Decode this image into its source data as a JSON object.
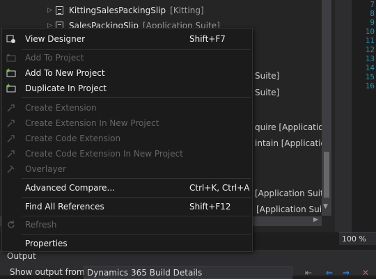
{
  "explorer": {
    "rows": [
      {
        "name": "KittingSalesPackingSlip",
        "tag": "[Kitting]"
      },
      {
        "name": "SalesPackingSlip",
        "tag": "[Application Suite]"
      }
    ],
    "partials": [
      "Suite]",
      "Suite]",
      "quire   [Application",
      "intain   [Applicatio",
      "[Application Suite]",
      "[Application Suite"
    ]
  },
  "editor": {
    "line_numbers": [
      "7",
      "8",
      "9",
      "10",
      "11",
      "12",
      "13",
      "14",
      "15",
      "16"
    ],
    "zoom": "100 %"
  },
  "context_menu": {
    "items": [
      {
        "icon": "view-designer-icon",
        "label": "View Designer",
        "shortcut": "Shift+F7",
        "enabled": true
      },
      {
        "icon": "add-to-project-icon",
        "label": "Add To Project",
        "shortcut": "",
        "enabled": false
      },
      {
        "icon": "add-to-new-project-icon",
        "label": "Add To New Project",
        "shortcut": "",
        "enabled": true
      },
      {
        "icon": "duplicate-in-project-icon",
        "label": "Duplicate In Project",
        "shortcut": "",
        "enabled": true
      },
      {
        "icon": "create-extension-icon",
        "label": "Create Extension",
        "shortcut": "",
        "enabled": false
      },
      {
        "icon": "create-extension-new-project-icon",
        "label": "Create Extension In New Project",
        "shortcut": "",
        "enabled": false
      },
      {
        "icon": "create-code-extension-icon",
        "label": "Create Code Extension",
        "shortcut": "",
        "enabled": false
      },
      {
        "icon": "create-code-extension-new-project-icon",
        "label": "Create Code Extension In New Project",
        "shortcut": "",
        "enabled": false
      },
      {
        "icon": "overlayer-icon",
        "label": "Overlayer",
        "shortcut": "",
        "enabled": false
      },
      {
        "icon": "",
        "label": "Advanced Compare...",
        "shortcut": "Ctrl+K, Ctrl+A",
        "enabled": true
      },
      {
        "icon": "",
        "label": "Find All References",
        "shortcut": "Shift+F12",
        "enabled": true
      },
      {
        "icon": "refresh-icon",
        "label": "Refresh",
        "shortcut": "",
        "enabled": false
      },
      {
        "icon": "",
        "label": "Properties",
        "shortcut": "",
        "enabled": true
      }
    ]
  },
  "output": {
    "title": "Output",
    "show_from_label": "Show output from:",
    "source": "Dynamics 365 Build Details"
  }
}
